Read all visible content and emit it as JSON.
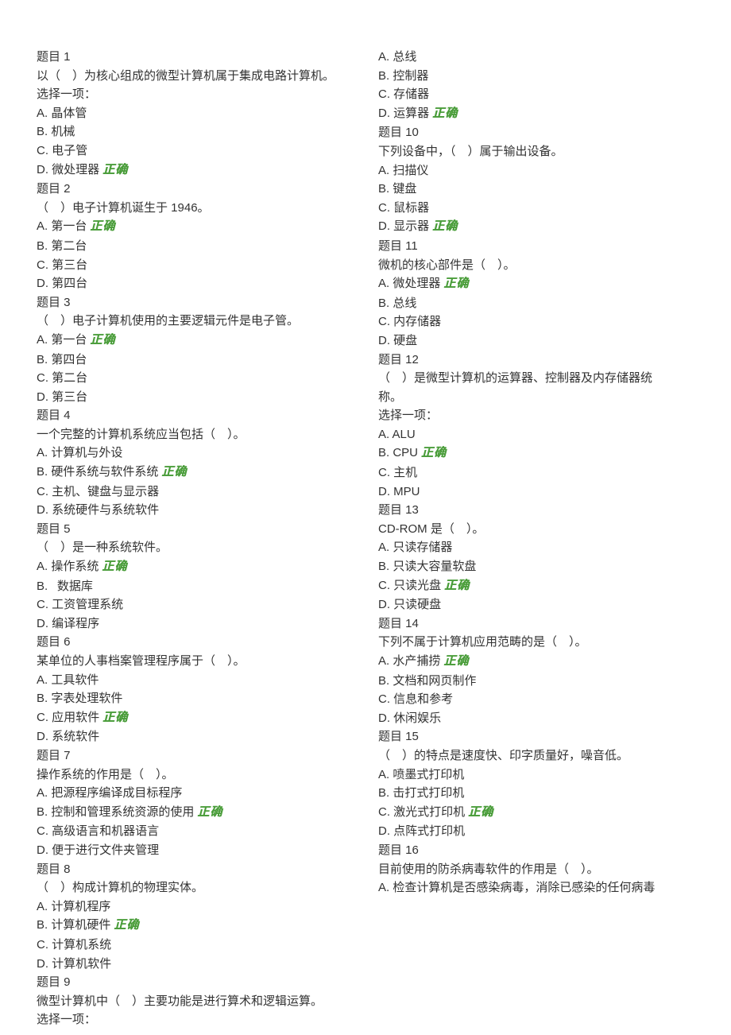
{
  "correct_label": "正确",
  "lines": [
    {
      "text": "题目 1"
    },
    {
      "text": "以（ ）为核心组成的微型计算机属于集成电路计算机。"
    },
    {
      "text": "选择一项："
    },
    {
      "text": "A. 晶体管"
    },
    {
      "text": "B. 机械"
    },
    {
      "text": "C. 电子管"
    },
    {
      "text": "D. 微处理器",
      "correct": true
    },
    {
      "text": "题目 2"
    },
    {
      "text": "（ ）电子计算机诞生于 1946。"
    },
    {
      "text": "A. 第一台",
      "correct": true
    },
    {
      "text": "B. 第二台"
    },
    {
      "text": "C. 第三台"
    },
    {
      "text": "D. 第四台"
    },
    {
      "text": "题目 3"
    },
    {
      "text": "（ ）电子计算机使用的主要逻辑元件是电子管。"
    },
    {
      "text": "A. 第一台",
      "correct": true
    },
    {
      "text": "B. 第四台"
    },
    {
      "text": "C. 第二台"
    },
    {
      "text": "D. 第三台"
    },
    {
      "text": "题目 4"
    },
    {
      "text": "一个完整的计算机系统应当包括（ ）。"
    },
    {
      "text": "A. 计算机与外设"
    },
    {
      "text": "B. 硬件系统与软件系统",
      "correct": true
    },
    {
      "text": "C. 主机、键盘与显示器"
    },
    {
      "text": "D. 系统硬件与系统软件"
    },
    {
      "text": "题目 5"
    },
    {
      "text": "（ ）是一种系统软件。"
    },
    {
      "text": "A. 操作系统",
      "correct": true
    },
    {
      "text": "B.  数据库"
    },
    {
      "text": "C. 工资管理系统"
    },
    {
      "text": "D. 编译程序"
    },
    {
      "text": "题目 6"
    },
    {
      "text": "某单位的人事档案管理程序属于（ ）。"
    },
    {
      "text": "A. 工具软件"
    },
    {
      "text": "B. 字表处理软件"
    },
    {
      "text": "C. 应用软件",
      "correct": true
    },
    {
      "text": "D. 系统软件"
    },
    {
      "text": "题目 7"
    },
    {
      "text": "操作系统的作用是（ ）。"
    },
    {
      "text": "A. 把源程序编译成目标程序"
    },
    {
      "text": "B. 控制和管理系统资源的使用",
      "correct": true
    },
    {
      "text": "C. 高级语言和机器语言"
    },
    {
      "text": "D. 便于进行文件夹管理"
    },
    {
      "text": "题目 8"
    },
    {
      "text": "（ ）构成计算机的物理实体。"
    },
    {
      "text": "A. 计算机程序"
    },
    {
      "text": "B. 计算机硬件",
      "correct": true
    },
    {
      "text": "C. 计算机系统"
    },
    {
      "text": "D. 计算机软件"
    },
    {
      "text": "题目 9"
    },
    {
      "text": "微型计算机中（ ）主要功能是进行算术和逻辑运算。"
    },
    {
      "text": "选择一项："
    },
    {
      "text": "A. 总线"
    },
    {
      "text": "B. 控制器"
    },
    {
      "text": "C. 存储器"
    },
    {
      "text": "D. 运算器",
      "correct": true
    },
    {
      "text": "题目 10"
    },
    {
      "text": "下列设备中，（ ）属于输出设备。"
    },
    {
      "text": "A. 扫描仪"
    },
    {
      "text": "B. 键盘"
    },
    {
      "text": "C. 鼠标器"
    },
    {
      "text": "D. 显示器",
      "correct": true
    },
    {
      "text": "题目 11"
    },
    {
      "text": "微机的核心部件是（ ）。"
    },
    {
      "text": "A. 微处理器",
      "correct": true
    },
    {
      "text": "B. 总线"
    },
    {
      "text": "C. 内存储器"
    },
    {
      "text": "D. 硬盘"
    },
    {
      "text": "题目 12"
    },
    {
      "text": "（ ）是微型计算机的运算器、控制器及内存储器统"
    },
    {
      "text": "称。"
    },
    {
      "text": "选择一项："
    },
    {
      "text": "A. ALU"
    },
    {
      "text": "B. CPU",
      "correct": true
    },
    {
      "text": "C. 主机"
    },
    {
      "text": "D. MPU"
    },
    {
      "text": "题目 13"
    },
    {
      "text": "CD-ROM 是（ ）。"
    },
    {
      "text": "A. 只读存储器"
    },
    {
      "text": "B. 只读大容量软盘"
    },
    {
      "text": "C. 只读光盘",
      "correct": true
    },
    {
      "text": "D. 只读硬盘"
    },
    {
      "text": "题目 14"
    },
    {
      "text": "下列不属于计算机应用范畴的是（ ）。"
    },
    {
      "text": "A. 水产捕捞",
      "correct": true
    },
    {
      "text": "B. 文档和网页制作"
    },
    {
      "text": "C. 信息和参考"
    },
    {
      "text": "D. 休闲娱乐"
    },
    {
      "text": "题目 15"
    },
    {
      "text": "（ ）的特点是速度快、印字质量好，噪音低。"
    },
    {
      "text": "A. 喷墨式打印机"
    },
    {
      "text": "B. 击打式打印机"
    },
    {
      "text": "C. 激光式打印机",
      "correct": true
    },
    {
      "text": "D. 点阵式打印机"
    },
    {
      "text": "题目 16"
    },
    {
      "text": "目前使用的防杀病毒软件的作用是（ ）。"
    },
    {
      "text": "A. 检查计算机是否感染病毒，消除已感染的任何病毒"
    }
  ]
}
